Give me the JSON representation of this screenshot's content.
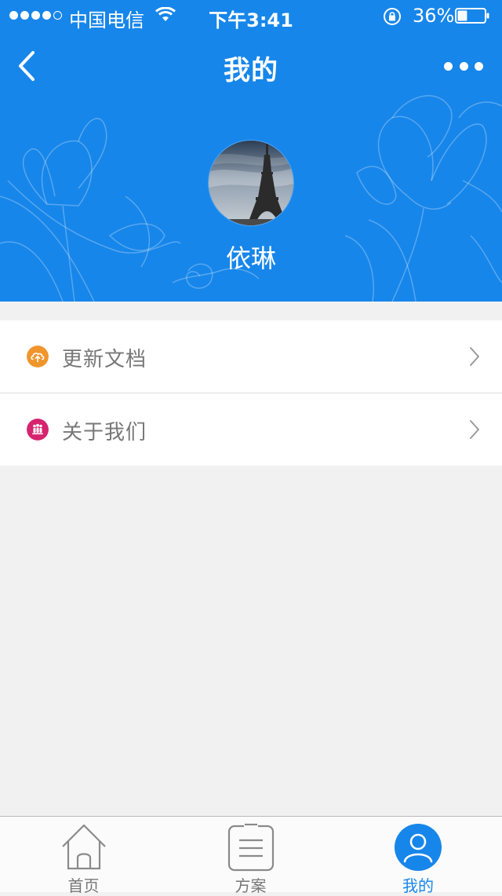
{
  "status_bar": {
    "carrier": "中国电信",
    "time": "下午3:41",
    "battery": "36%",
    "battery_level": 0.36
  },
  "nav": {
    "title": "我的"
  },
  "profile": {
    "name": "依琳"
  },
  "menu": {
    "items": [
      {
        "label": "更新文档",
        "icon": "cloud-upload-icon",
        "color": "#f0952c"
      },
      {
        "label": "关于我们",
        "icon": "people-icon",
        "color": "#d6246e"
      }
    ]
  },
  "tabs": [
    {
      "label": "首页",
      "icon": "home-icon",
      "active": false
    },
    {
      "label": "方案",
      "icon": "document-list-icon",
      "active": false
    },
    {
      "label": "我的",
      "icon": "user-icon",
      "active": true
    }
  ],
  "colors": {
    "brand": "#1786ea",
    "background": "#f1f1f1",
    "tab_inactive": "#777777"
  }
}
